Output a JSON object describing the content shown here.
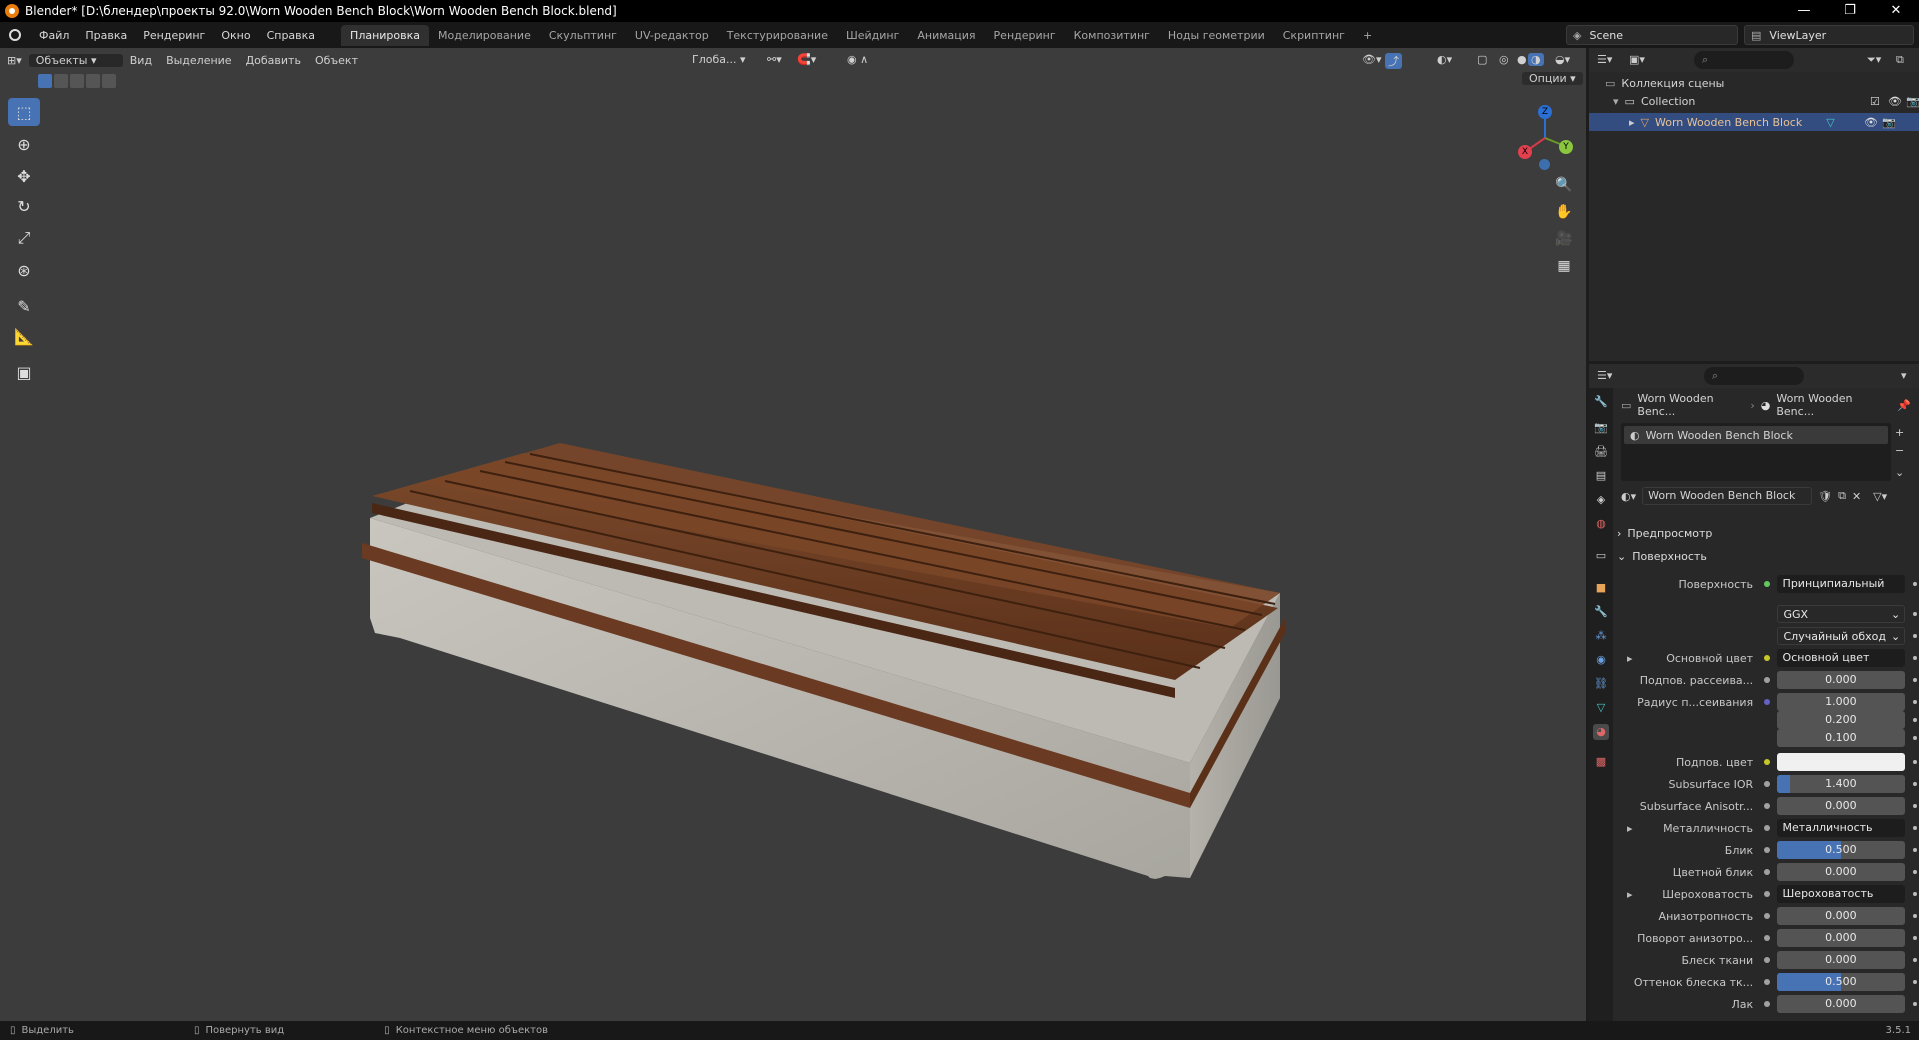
{
  "window": {
    "title": "Blender* [D:\\блендер\\проекты 92.0\\Worn Wooden Bench Block\\Worn Wooden Bench Block.blend]",
    "controls": [
      "—",
      "❐",
      "✕"
    ]
  },
  "menubar": {
    "menus": [
      "Файл",
      "Правка",
      "Рендеринг",
      "Окно",
      "Справка"
    ],
    "workspaces": [
      "Планировка",
      "Моделирование",
      "Скульптинг",
      "UV-редактор",
      "Текстурирование",
      "Шейдинг",
      "Анимация",
      "Рендеринг",
      "Композитинг",
      "Ноды геометрии",
      "Скриптинг"
    ],
    "active_workspace": "Планировка",
    "add_tab": "+",
    "scene": "Scene",
    "view_layer": "ViewLayer"
  },
  "viewport_header": {
    "mode": "Объекты",
    "menus": [
      "Вид",
      "Выделение",
      "Добавить",
      "Объект"
    ],
    "orientation": "Глоба...",
    "options": "Опции"
  },
  "gizmo": {
    "x": "X",
    "y": "Y",
    "z": "Z"
  },
  "outliner": {
    "scene_collection": "Коллекция сцены",
    "collection": "Collection",
    "object": "Worn Wooden Bench Block"
  },
  "properties": {
    "breadcrumb_object": "Worn Wooden Benc...",
    "breadcrumb_material": "Worn Wooden Benc...",
    "slot_name": "Worn Wooden Bench Block",
    "material_name": "Worn Wooden Bench Block",
    "panel_preview": "Предпросмотр",
    "panel_surface": "Поверхность",
    "rows": [
      {
        "label": "Поверхность",
        "value": "Принципиальный BSDF",
        "kind": "link",
        "socket": "#63c763"
      },
      {
        "label": "",
        "value": "GGX",
        "kind": "select"
      },
      {
        "label": "",
        "value": "Случайный обход",
        "kind": "select"
      },
      {
        "label": "Основной цвет",
        "value": "Основной цвет",
        "kind": "link",
        "socket": "#c7c729",
        "expander": true
      },
      {
        "label": "Подпов. рассеива...",
        "value": "0.000",
        "kind": "num",
        "socket": "#a1a1a1",
        "fill": 0
      },
      {
        "label": "Радиус п...сеивания",
        "value": "1.000",
        "kind": "num",
        "socket": "#6363c7",
        "fill": 0
      },
      {
        "label": "",
        "value": "0.200",
        "kind": "num",
        "fill": 0
      },
      {
        "label": "",
        "value": "0.100",
        "kind": "num",
        "fill": 0
      },
      {
        "label": "Подпов. цвет",
        "value": "",
        "kind": "color",
        "socket": "#c7c729"
      },
      {
        "label": "Subsurface IOR",
        "value": "1.400",
        "kind": "num",
        "socket": "#a1a1a1",
        "fill": 0.1
      },
      {
        "label": "Subsurface Anisotr...",
        "value": "0.000",
        "kind": "num",
        "socket": "#a1a1a1",
        "fill": 0
      },
      {
        "label": "Металличность",
        "value": "Металличность",
        "kind": "link",
        "socket": "#a1a1a1",
        "expander": true
      },
      {
        "label": "Блик",
        "value": "0.500",
        "kind": "num",
        "socket": "#a1a1a1",
        "fill": 0.5
      },
      {
        "label": "Цветной блик",
        "value": "0.000",
        "kind": "num",
        "socket": "#a1a1a1",
        "fill": 0
      },
      {
        "label": "Шероховатость",
        "value": "Шероховатость",
        "kind": "link",
        "socket": "#a1a1a1",
        "expander": true
      },
      {
        "label": "Анизотропность",
        "value": "0.000",
        "kind": "num",
        "socket": "#a1a1a1",
        "fill": 0
      },
      {
        "label": "Поворот анизотро...",
        "value": "0.000",
        "kind": "num",
        "socket": "#a1a1a1",
        "fill": 0
      },
      {
        "label": "Блеск ткани",
        "value": "0.000",
        "kind": "num",
        "socket": "#a1a1a1",
        "fill": 0
      },
      {
        "label": "Оттенок блеска тк...",
        "value": "0.500",
        "kind": "num",
        "socket": "#a1a1a1",
        "fill": 0.5
      },
      {
        "label": "Лак",
        "value": "0.000",
        "kind": "num",
        "socket": "#a1a1a1",
        "fill": 0
      }
    ]
  },
  "statusbar": {
    "select": "Выделить",
    "rotate": "Повернуть вид",
    "context": "Контекстное меню объектов",
    "version": "3.5.1"
  },
  "colors": {
    "accent": "#4772b3",
    "wood": "#6b3a22",
    "concrete": "#b7b4ad"
  }
}
